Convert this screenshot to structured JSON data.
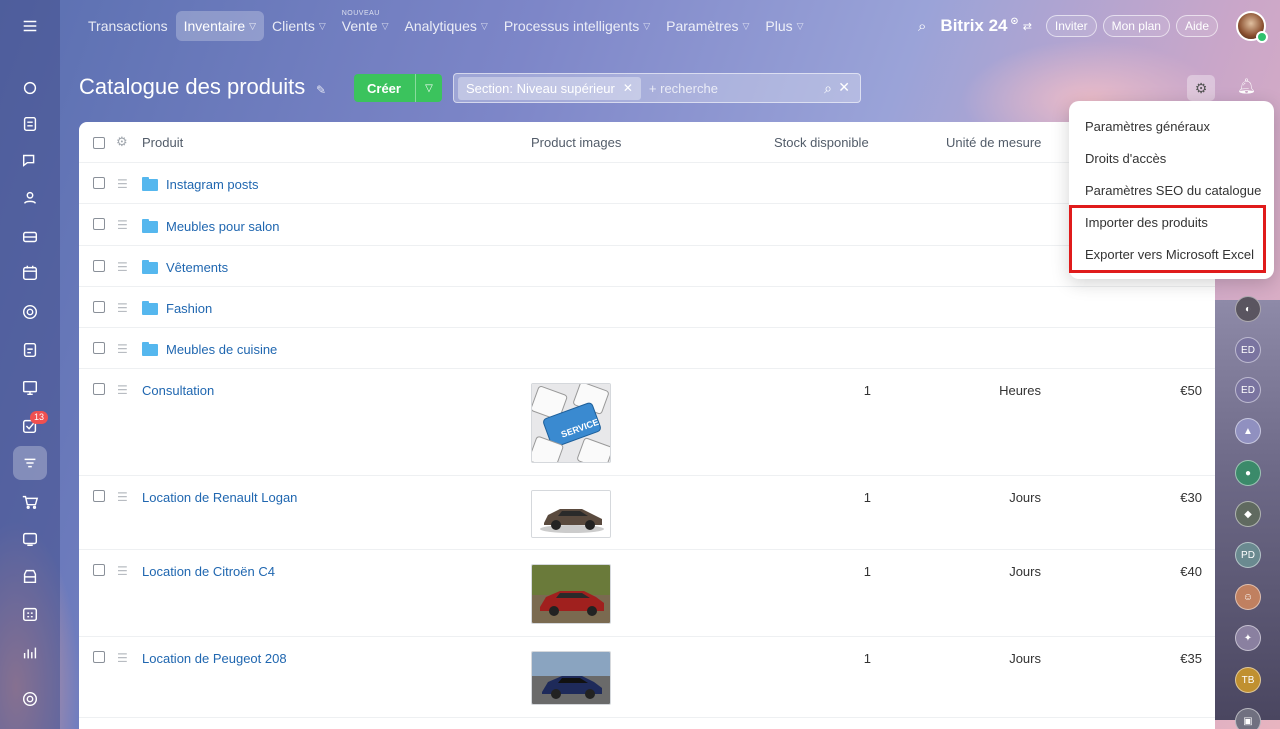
{
  "nav": {
    "items": [
      {
        "label": "Transactions",
        "chevron": false
      },
      {
        "label": "Inventaire",
        "chevron": true,
        "active": true
      },
      {
        "label": "Clients",
        "chevron": true
      },
      {
        "label": "Vente",
        "chevron": true,
        "badge": "NOUVEAU"
      },
      {
        "label": "Analytiques",
        "chevron": true
      },
      {
        "label": "Processus intelligents",
        "chevron": true
      },
      {
        "label": "Paramètres",
        "chevron": true
      },
      {
        "label": "Plus",
        "chevron": true
      }
    ],
    "brand": "Bitrix 24",
    "invite": "Inviter",
    "plan": "Mon plan",
    "help": "Aide"
  },
  "sidebar": {
    "icons": [
      "chat-bubble-icon",
      "feed-icon",
      "messages-icon",
      "contacts-icon",
      "inbox-icon",
      "calendar-icon",
      "sites-icon",
      "documents-icon",
      "board-icon",
      "tasks-icon",
      "inventory-icon",
      "cart-icon",
      "crm-icon",
      "store-icon",
      "planner-icon",
      "analytics-icon",
      "settings-icon"
    ],
    "tasks_badge": "13"
  },
  "page": {
    "title": "Catalogue des produits",
    "create_label": "Créer",
    "filter_tag": "Section: Niveau supérieur",
    "search_placeholder": "+ recherche"
  },
  "table": {
    "headers": {
      "product": "Produit",
      "images": "Product images",
      "stock": "Stock disponible",
      "unit": "Unité de mesure"
    },
    "folders": [
      "Instagram posts",
      "Meubles pour salon",
      "Vêtements",
      "Fashion",
      "Meubles de cuisine"
    ],
    "products": [
      {
        "name": "Consultation",
        "stock": "1",
        "unit": "Heures",
        "price": "€50",
        "image": "service-key"
      },
      {
        "name": "Location de Renault Logan",
        "stock": "1",
        "unit": "Jours",
        "price": "€30",
        "image": "car-brown"
      },
      {
        "name": "Location de Citroën C4",
        "stock": "1",
        "unit": "Jours",
        "price": "€40",
        "image": "car-red"
      },
      {
        "name": "Location de Peugeot 208",
        "stock": "1",
        "unit": "Jours",
        "price": "€35",
        "image": "car-blue"
      }
    ]
  },
  "menu": {
    "items": [
      "Paramètres généraux",
      "Droits d'accès",
      "Paramètres SEO du catalogue",
      "Importer des produits",
      "Exporter vers Microsoft Excel"
    ]
  },
  "right_strip": {
    "avatars": [
      "ED",
      "ED",
      "PD",
      "TB"
    ]
  },
  "colors": {
    "accent_green": "#3bc35d",
    "link_blue": "#2067b0",
    "folder_blue": "#55b7ee",
    "highlight_red": "#e01b1b"
  }
}
